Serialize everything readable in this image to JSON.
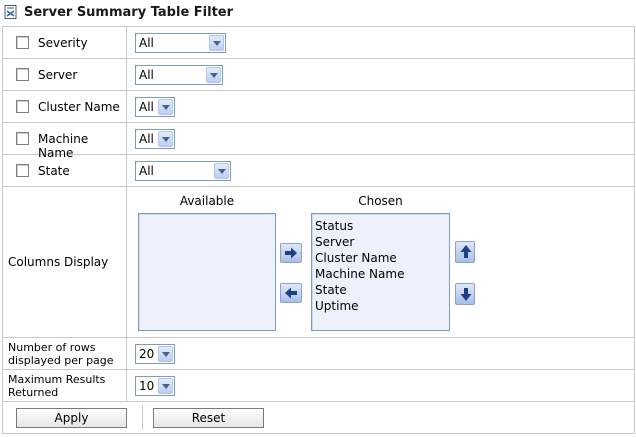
{
  "title": "Server Summary Table Filter",
  "filters": {
    "severity": {
      "label": "Severity",
      "value": "All"
    },
    "server": {
      "label": "Server",
      "value": "All"
    },
    "cluster_name": {
      "label": "Cluster Name",
      "value": "All"
    },
    "machine_name": {
      "label": "Machine Name",
      "value": "All"
    },
    "state": {
      "label": "State",
      "value": "All"
    }
  },
  "columns_display": {
    "label": "Columns Display",
    "available_header": "Available",
    "chosen_header": "Chosen",
    "available": [],
    "chosen": [
      "Status",
      "Server",
      "Cluster Name",
      "Machine Name",
      "State",
      "Uptime"
    ]
  },
  "rows_per_page": {
    "label": "Number of rows displayed per page",
    "value": "20"
  },
  "max_results": {
    "label": "Maximum Results Returned",
    "value": "10"
  },
  "buttons": {
    "apply": "Apply",
    "reset": "Reset"
  },
  "colors": {
    "border": "#c8c8c8",
    "list_bg": "#ecf1fb",
    "button_blue": "#2a4d9e"
  }
}
